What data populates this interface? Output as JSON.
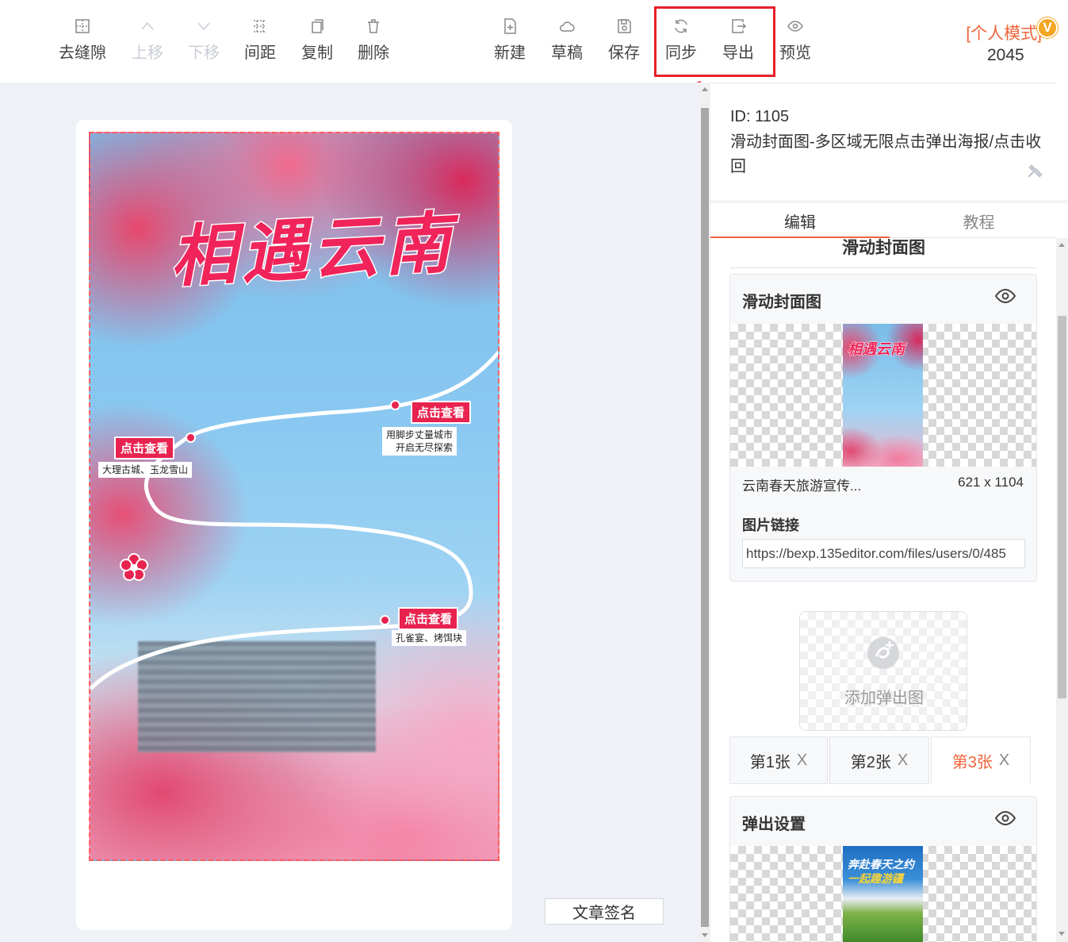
{
  "toolbar": {
    "items": [
      {
        "label": "去缝隙",
        "icon": "grid-gap-icon",
        "disabled": false
      },
      {
        "label": "上移",
        "icon": "chevron-up-icon",
        "disabled": true
      },
      {
        "label": "下移",
        "icon": "chevron-down-icon",
        "disabled": true
      },
      {
        "label": "间距",
        "icon": "spacing-icon",
        "disabled": false
      },
      {
        "label": "复制",
        "icon": "copy-icon",
        "disabled": false
      },
      {
        "label": "删除",
        "icon": "trash-icon",
        "disabled": false
      },
      {
        "label": "新建",
        "icon": "new-file-icon",
        "disabled": false
      },
      {
        "label": "草稿",
        "icon": "cloud-icon",
        "disabled": false
      },
      {
        "label": "保存",
        "icon": "save-icon",
        "disabled": false
      },
      {
        "label": "同步",
        "icon": "sync-icon",
        "disabled": false
      },
      {
        "label": "导出",
        "icon": "export-icon",
        "disabled": false
      },
      {
        "label": "预览",
        "icon": "eye-icon",
        "disabled": false
      }
    ],
    "mode_label": "[个人模式]",
    "vip_badge": "V",
    "mode_count": "2045"
  },
  "poster": {
    "title": "相遇云南",
    "tags": [
      {
        "tag": "点击查看",
        "sub": "用脚步丈量城市\n开启无尽探索"
      },
      {
        "tag": "点击查看",
        "sub": "大理古城、玉龙雪山"
      },
      {
        "tag": "点击查看",
        "sub": "孔雀宴、烤饵块"
      }
    ]
  },
  "editor": {
    "sign_button": "文章签名"
  },
  "panel": {
    "id_text": "ID: 1105",
    "title": "滑动封面图-多区域无限点击弹出海报/点击收回",
    "tabs": {
      "edit": "编辑",
      "tutorial": "教程"
    },
    "section_title": "滑动封面图",
    "cover_card": {
      "title": "滑动封面图",
      "thumb_title": "相遇云南",
      "image_name": "云南春天旅游宣传...",
      "image_size": "621 x 1104",
      "link_label": "图片链接",
      "link_value": "https://bexp.135editor.com/files/users/0/485"
    },
    "add_popup_label": "添加弹出图",
    "popup_tabs": [
      {
        "label": "第1张",
        "active": false
      },
      {
        "label": "第2张",
        "active": false
      },
      {
        "label": "第3张",
        "active": true
      }
    ],
    "popup_close": "X",
    "popup_card": {
      "title": "弹出设置",
      "thumb_line1": "奔赴春天之约",
      "thumb_line2": "一起趣游疆"
    }
  },
  "colors": {
    "accent": "#f0633a",
    "highlight": "#e8202a",
    "poster_tag": "#e8234f"
  }
}
